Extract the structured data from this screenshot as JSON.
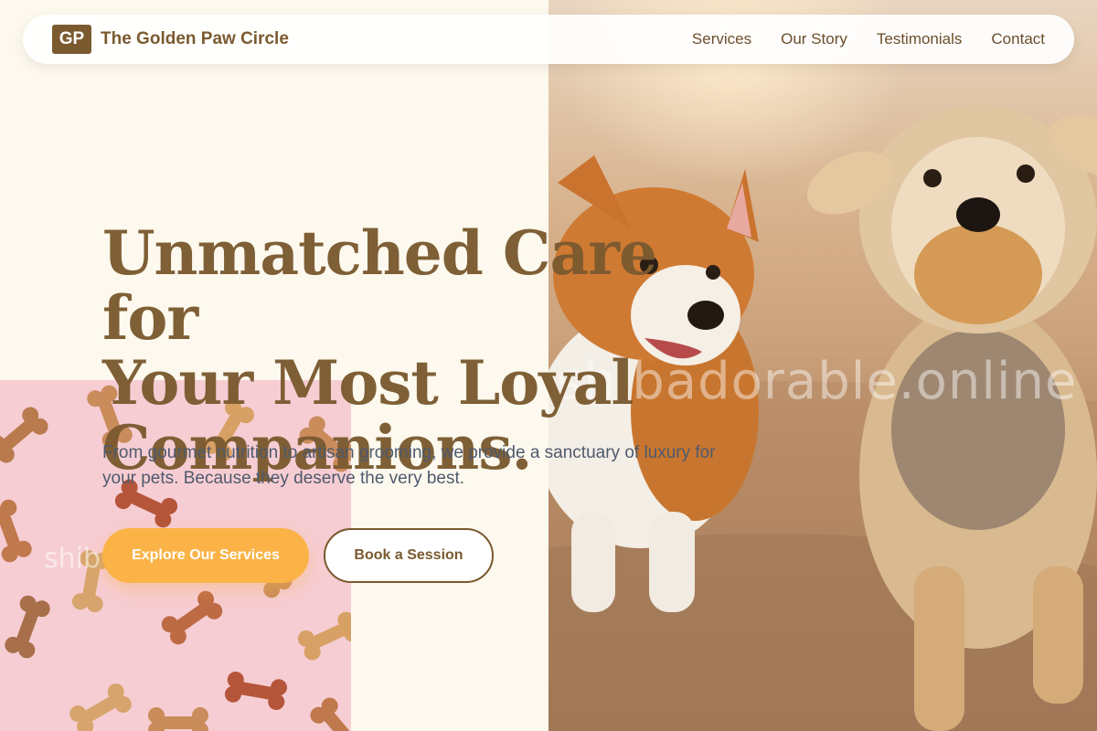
{
  "brand": {
    "logo_text": "GP",
    "name": "The Golden Paw Circle"
  },
  "nav": {
    "items": [
      {
        "label": "Services"
      },
      {
        "label": "Our Story"
      },
      {
        "label": "Testimonials"
      },
      {
        "label": "Contact"
      }
    ]
  },
  "hero": {
    "title_line1": "Unmatched Care for",
    "title_line2": "Your Most Loyal",
    "title_line3": "Companions.",
    "subtitle": "From gourmet nutrition to artisan grooming, we provide a sanctuary of luxury for your pets. Because they deserve the very best.",
    "primary_button": "Explore Our Services",
    "secondary_button": "Book a Session"
  },
  "images": {
    "hero_photo_watermark": "shibadorable.online",
    "treats_photo_watermark": "shib"
  },
  "colors": {
    "brand_brown": "#7b5a2f",
    "accent_orange": "#fbb347",
    "page_bg": "#fdf9ee",
    "body_text": "#4e5a6e"
  }
}
